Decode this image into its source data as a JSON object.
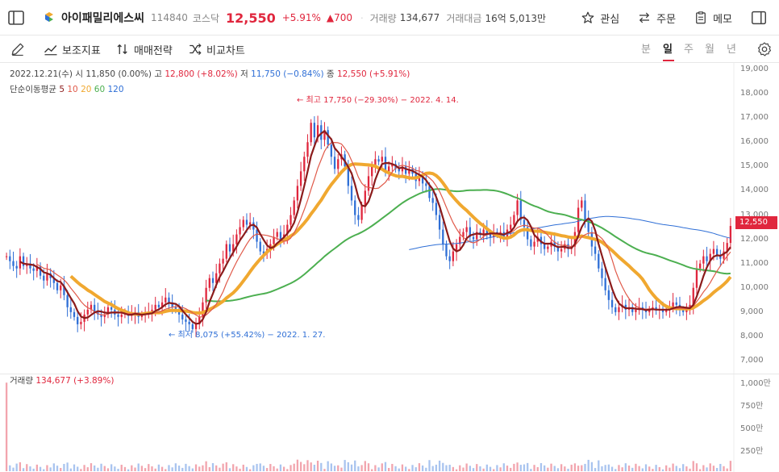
{
  "header": {
    "stock_name": "아이패밀리에스씨",
    "code": "114840",
    "market": "코스닥",
    "price": "12,550",
    "change_pct": "+5.91%",
    "change_abs": "▲700",
    "volume_label": "거래량",
    "volume_value": "134,677",
    "amount_label": "거래대금",
    "amount_value": "16억 5,013만",
    "actions": {
      "watchlist": "관심",
      "order": "주문",
      "memo": "메모"
    },
    "icons": [
      "sidebar-left-icon",
      "logo-icon",
      "star-icon",
      "arrows-exchange-icon",
      "memo-icon",
      "sidebar-right-icon"
    ]
  },
  "toolbar": {
    "indicators": "보조지표",
    "strategy": "매매전략",
    "compare": "비교차트",
    "periods": [
      "분",
      "일",
      "주",
      "월",
      "년"
    ],
    "active_period": "일",
    "icons": [
      "pencil-icon",
      "indicator-icon",
      "strategy-icon",
      "compare-icon",
      "settings-icon"
    ]
  },
  "info": {
    "date": "2022.12.21(수)",
    "open_label": "시",
    "open": "11,850 (0.00%)",
    "high_label": "고",
    "high": "12,800 (+8.02%)",
    "low_label": "저",
    "low": "11,750 (−0.84%)",
    "close_label": "종",
    "close": "12,550 (+5.91%)",
    "ma_label": "단순이동평균",
    "ma_periods": [
      "5",
      "10",
      "20",
      "60",
      "120"
    ]
  },
  "annotations": {
    "high": "← 최고 17,750 (−29.30%) − 2022. 4. 14.",
    "low": "← 최저 8,075 (+55.42%) − 2022. 1. 27."
  },
  "volume": {
    "label": "거래량",
    "value": "134,677 (+3.89%)",
    "axis": [
      "1,000만",
      "750만",
      "500만",
      "250만"
    ]
  },
  "colors": {
    "up": "#e0263d",
    "down": "#2f6fd6",
    "ma5": "#8b1b1b",
    "ma10": "#e05a4a",
    "ma20": "#f0a830",
    "ma60": "#4caf50",
    "ma120": "#2f6fd6"
  },
  "chart_data": {
    "type": "candlestick",
    "y_ticks": [
      "19,000",
      "18,000",
      "17,000",
      "16,000",
      "15,000",
      "14,000",
      "13,000",
      "12,000",
      "11,000",
      "10,000",
      "9,000",
      "8,000",
      "7,000"
    ],
    "ylim": [
      7000,
      19000
    ],
    "current_price_tag": "12,550",
    "close": [
      11300,
      11100,
      10900,
      10800,
      11300,
      10900,
      11000,
      10800,
      10700,
      10900,
      10500,
      10300,
      10600,
      10400,
      10200,
      9900,
      10100,
      9700,
      9200,
      9000,
      8800,
      8500,
      8600,
      8900,
      9100,
      9300,
      9000,
      8900,
      8800,
      8900,
      9200,
      9100,
      8900,
      8800,
      8900,
      9000,
      8850,
      8900,
      9000,
      8800,
      8900,
      8950,
      9000,
      9100,
      9300,
      9200,
      9400,
      9600,
      9400,
      9200,
      9100,
      8900,
      8700,
      8600,
      8500,
      8300,
      8500,
      8800,
      9400,
      10000,
      10400,
      10200,
      10600,
      11000,
      11200,
      11800,
      11500,
      11800,
      12200,
      12500,
      12800,
      12600,
      12700,
      12400,
      11900,
      11500,
      11400,
      11600,
      11800,
      12100,
      12300,
      12000,
      12200,
      12600,
      13000,
      13600,
      14200,
      14800,
      15400,
      16000,
      16800,
      16200,
      16700,
      16100,
      16500,
      15900,
      15400,
      14900,
      15300,
      15500,
      15000,
      14200,
      13600,
      13000,
      12800,
      13400,
      14000,
      14600,
      15000,
      15300,
      15200,
      15400,
      14800,
      15000,
      15100,
      14900,
      14800,
      15000,
      14700,
      14900,
      14700,
      14400,
      14600,
      14300,
      14200,
      13700,
      13500,
      13000,
      12400,
      11800,
      11300,
      11100,
      11500,
      11800,
      12100,
      12300,
      12500,
      12100,
      12000,
      12300,
      12200,
      12400,
      12200,
      12100,
      12300,
      12200,
      12300,
      12100,
      12400,
      12600,
      13000,
      13600,
      12800,
      12500,
      12000,
      11700,
      11900,
      12100,
      11800,
      11600,
      11700,
      11900,
      11700,
      11500,
      11600,
      11800,
      11600,
      11700,
      12300,
      13300,
      13600,
      12800,
      12300,
      11700,
      11400,
      10800,
      10400,
      9900,
      9500,
      9200,
      9000,
      9200,
      9300,
      9100,
      9200,
      9000,
      9100,
      9200,
      9100,
      9000,
      9100,
      9200,
      9100,
      9100,
      9000,
      9100,
      9200,
      9400,
      9300,
      9100,
      9000,
      9100,
      9300,
      10000,
      10800,
      11000,
      11300,
      11100,
      11400,
      11600,
      11300,
      11200,
      11500,
      11850,
      12550
    ]
  }
}
